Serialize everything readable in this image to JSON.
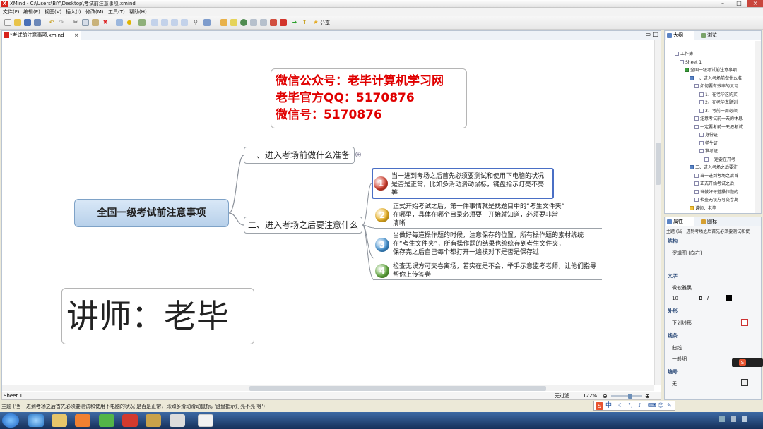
{
  "window": {
    "title": "XMind - C:\\Users\\BiY\\Desktop\\考试前注意事项.xmind",
    "app_icon": "X"
  },
  "menu": [
    "文件(F)",
    "编辑(E)",
    "视图(V)",
    "插入(I)",
    "修改(M)",
    "工具(T)",
    "帮助(H)"
  ],
  "toolbar": {
    "share_label": "分享"
  },
  "editor": {
    "tab_label": "*考试前注意事项.xmind"
  },
  "mindmap": {
    "promo_lines": [
      "微信公众号：老毕计算机学习网",
      "老毕官方QQ：5170876",
      "微信号：5170876"
    ],
    "central": "全国一级考试前注意事项",
    "branch1": "一、进入考场前做什么准备",
    "branch2": "二、进入考场之后要注意什么",
    "expand": "+",
    "leaves": [
      {
        "num": "1",
        "color": "#d13b2b",
        "lines": [
          "当一进到考场之后首先必须要测试和使用下电脑的状况",
          "是否是正常，比如多滑动滑动鼠标，键盘指示灯亮不亮",
          "等"
        ]
      },
      {
        "num": "2",
        "color": "#e9b01f",
        "lines": [
          "正式开始考试之后，第一件事情就是找题目中的“考生文件夹”",
          "在哪里，具体在哪个目录必须要一开始就知道，必须要非常",
          "清晰"
        ]
      },
      {
        "num": "3",
        "color": "#3f8fd0",
        "lines": [
          "当做好每道操作题的时候，注意保存的位置，所有操作题的素材统统",
          "在“考生文件夹”，所有操作题的结果也统统存到考生文件夹，",
          "保存完之后自己每个都打开一遍核对下是否是保存过"
        ]
      },
      {
        "num": "4",
        "color": "#5ea63a",
        "lines": [
          "检查无误方可交卷离场，若实在是不会，举手示意监考老师，让他们指导",
          "帮你上传答卷"
        ]
      }
    ],
    "teacher": "讲师：老毕"
  },
  "sheetbar": {
    "sheet_tab": "Sheet 1",
    "filter": "无过滤",
    "zoom": "122%"
  },
  "outline": {
    "tabs": [
      "大纲",
      "浏览"
    ],
    "rows": [
      {
        "text": "工作簿",
        "indent": 0,
        "icon": ""
      },
      {
        "text": "Sheet 1",
        "indent": 1,
        "icon": ""
      },
      {
        "text": "全国一级考试前注意事项",
        "indent": 2,
        "icon": "green"
      },
      {
        "text": "一、进入考场前做什么准",
        "indent": 3,
        "icon": "blue"
      },
      {
        "text": "如何要有效率的复习",
        "indent": 4,
        "icon": ""
      },
      {
        "text": "1、在老毕这购买",
        "indent": 5,
        "icon": ""
      },
      {
        "text": "2、在老毕真题训",
        "indent": 5,
        "icon": ""
      },
      {
        "text": "3、考前一周必须",
        "indent": 5,
        "icon": ""
      },
      {
        "text": "注意考试前一天的休息",
        "indent": 4,
        "icon": ""
      },
      {
        "text": "一定要考前一天把考试",
        "indent": 4,
        "icon": ""
      },
      {
        "text": "身份证",
        "indent": 5,
        "icon": ""
      },
      {
        "text": "学生证",
        "indent": 5,
        "icon": ""
      },
      {
        "text": "准考证",
        "indent": 5,
        "icon": ""
      },
      {
        "text": "一定要在开考",
        "indent": 6,
        "icon": ""
      },
      {
        "text": "二、进入考场之后要注",
        "indent": 3,
        "icon": "blue"
      },
      {
        "text": "当一进到考场之后首",
        "indent": 4,
        "icon": ""
      },
      {
        "text": "正式开始考试之后，",
        "indent": 4,
        "icon": ""
      },
      {
        "text": "当做好每道操作题的",
        "indent": 4,
        "icon": ""
      },
      {
        "text": "检查无误方可交卷离",
        "indent": 4,
        "icon": ""
      },
      {
        "text": "讲师：老毕",
        "indent": 3,
        "icon": "yellow"
      }
    ]
  },
  "properties": {
    "tabs": [
      "属性",
      "图标"
    ],
    "topic_line": "主题 (当一进到考场之后首先必须要测试和使",
    "structure_label": "结构",
    "structure_value": "逻辑图 (向右)",
    "text_label": "文字",
    "font_name": "微软雅黑",
    "font_size": "10",
    "bold": "B",
    "italic": "I",
    "shape_label": "外形",
    "shape_value": "下划线形",
    "line_label": "线条",
    "line_value": "曲线",
    "line_width": "一般细",
    "numbering_label": "编号",
    "numbering_value": "无"
  },
  "status": {
    "text": "主题 ('当一进到考场之后首先必须要测试和使用下电脑的状况 是否是正常，比如多滑动滑动鼠标，键盘指示灯亮不亮 等')"
  },
  "ime": {
    "logo": "S",
    "lang": "中"
  }
}
